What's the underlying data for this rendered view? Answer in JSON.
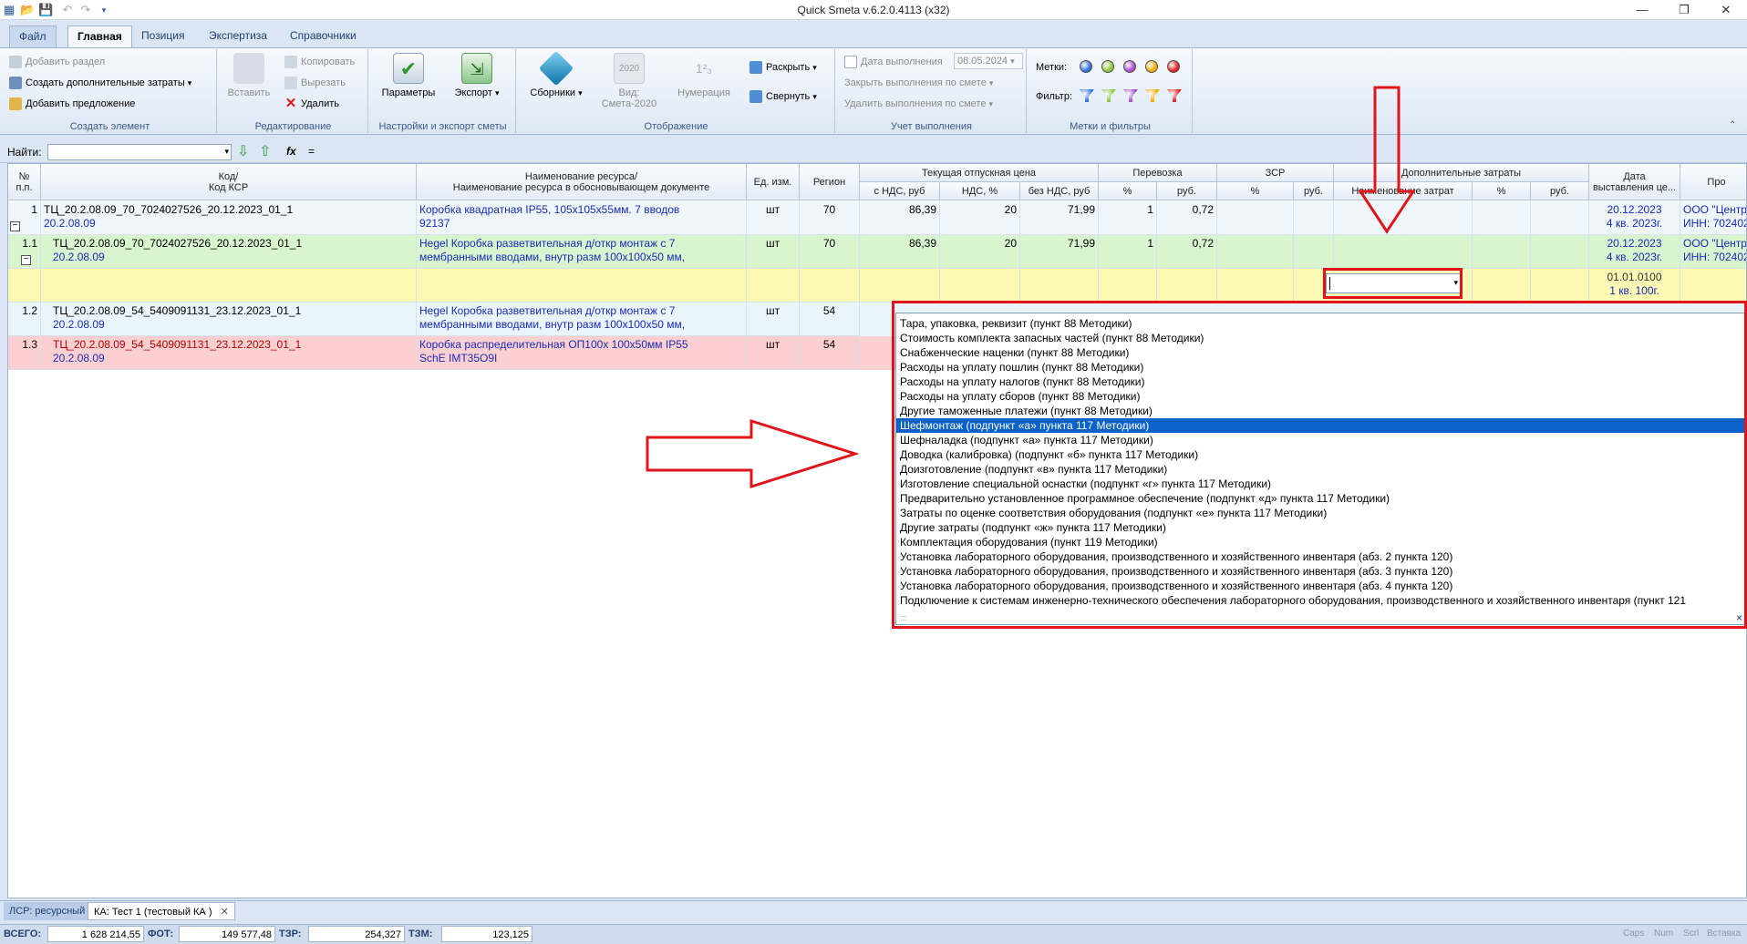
{
  "window": {
    "title": "Quick Smeta v.6.2.0.4113 (x32)",
    "minimize": "—",
    "restore": "❐",
    "close": "✕"
  },
  "ribbon_tabs": [
    "Файл",
    "Главная",
    "Позиция",
    "Экспертиза",
    "Справочники"
  ],
  "ribbon": {
    "create": {
      "add_section": "Добавить раздел",
      "create_extra_costs": "Создать дополнительные затраты",
      "add_offer": "Добавить предложение",
      "title": "Создать элемент"
    },
    "edit": {
      "paste": "Вставить",
      "copy": "Копировать",
      "cut": "Вырезать",
      "delete": "Удалить",
      "title": "Редактирование"
    },
    "settings": {
      "params": "Параметры",
      "export": "Экспорт",
      "title": "Настройки и экспорт сметы"
    },
    "display": {
      "collections": "Сборники",
      "view": "Вид:",
      "view_value": "Смета-2020",
      "numbering": "Нумерация",
      "expand": "Раскрыть",
      "collapse": "Свернуть",
      "title": "Отображение"
    },
    "tracking": {
      "exec_date": "Дата выполнения",
      "exec_date_value": "08.05.2024",
      "close_exec": "Закрыть выполнения по смете",
      "delete_exec": "Удалить выполнения по смете",
      "title": "Учет выполнения"
    },
    "marks": {
      "marks_label": "Метки:",
      "filter_label": "Фильтр:",
      "title": "Метки и фильтры",
      "colors": [
        "#2f6fd6",
        "#8cc63f",
        "#a64ac9",
        "#f2a900",
        "#e02020"
      ]
    }
  },
  "findbar": {
    "label": "Найти:",
    "value": "",
    "fx": "fx",
    "eq": "="
  },
  "headers": {
    "num": "№\nп.п.",
    "code": "Код/\nКод КСР",
    "name": "Наименование ресурса/\nНаименование ресурса в обосновывающем документе",
    "unit": "Ед. изм.",
    "region": "Регион",
    "price_group": "Текущая отпускная цена",
    "price_vat": "с НДС, руб",
    "vat_pct": "НДС, %",
    "price_novat": "без НДС, руб",
    "transport_group": "Перевозка",
    "tr_pct": "%",
    "tr_rub": "руб.",
    "zsr_group": "ЗСР",
    "zsr_pct": "%",
    "zsr_rub": "руб.",
    "extra_group": "Дополнительные затраты",
    "extra_name": "Наименование затрат",
    "extra_pct": "%",
    "extra_rub": "руб.",
    "date": "Дата\nвыставления це...",
    "supplier": "Про"
  },
  "rows": [
    {
      "num": "1",
      "code": "ТЦ_20.2.08.09_70_7024027526_20.12.2023_01_1",
      "ksr": "20.2.08.09",
      "name1": "Коробка квадратная IP55, 105х105х55мм. 7 вводов",
      "name2": "92137",
      "unit": "шт",
      "region": "70",
      "price_vat": "86,39",
      "vat": "20",
      "price_novat": "71,99",
      "tr_pct": "1",
      "tr_rub": "0,72",
      "date1": "20.12.2023",
      "date2": "4 кв. 2023г.",
      "sup1": "ООО \"Центр",
      "sup2": "ИНН: 702402"
    },
    {
      "num": "1.1",
      "code": "ТЦ_20.2.08.09_70_7024027526_20.12.2023_01_1",
      "ksr": "20.2.08.09",
      "name1": "Hegel Коробка разветвительная д/откр монтаж с 7",
      "name2": "мембранными вводами, внутр разм 100х100х50 мм,",
      "unit": "шт",
      "region": "70",
      "price_vat": "86,39",
      "vat": "20",
      "price_novat": "71,99",
      "tr_pct": "1",
      "tr_rub": "0,72",
      "date1": "20.12.2023",
      "date2": "4 кв. 2023г.",
      "sup1": "ООО \"Центр",
      "sup2": "ИНН: 702402"
    },
    {
      "date1": "01.01.0100",
      "date2": "1 кв. 100г."
    },
    {
      "num": "1.2",
      "code": "ТЦ_20.2.08.09_54_5409091131_23.12.2023_01_1",
      "ksr": "20.2.08.09",
      "name1": "Hegel Коробка разветвительная д/откр монтаж с 7",
      "name2": "мембранными вводами, внутр разм 100х100х50 мм,",
      "unit": "шт",
      "region": "54"
    },
    {
      "num": "1.3",
      "code": "ТЦ_20.2.08.09_54_5409091131_23.12.2023_01_1",
      "ksr": "20.2.08.09",
      "name1": "Коробка распределительная ОП100х 100х50мм IP55",
      "name2": "SchE IMT35O9I",
      "unit": "шт",
      "region": "54"
    }
  ],
  "dropdown": {
    "value": "",
    "items": [
      "Тара, упаковка, реквизит (пункт 88 Методики)",
      "Стоимость комплекта запасных частей (пункт 88 Методики)",
      "Снабженческие наценки (пункт 88 Методики)",
      "Расходы на уплату пошлин (пункт 88 Методики)",
      "Расходы на уплату налогов (пункт 88 Методики)",
      "Расходы на уплату сборов (пункт 88 Методики)",
      "Другие таможенные платежи (пункт 88 Методики)",
      "Шефмонтаж (подпункт «а» пункта 117 Методики)",
      "Шефналадка (подпункт «а» пункта 117 Методики)",
      "Доводка (калибровка) (подпункт «б» пункта 117 Методики)",
      "Доизготовление (подпункт «в» пункта 117 Методики)",
      "Изготовление специальной оснастки (подпункт «г» пункта 117 Методики)",
      "Предварительно установленное программное обеспечение (подпункт «д» пункта 117 Методики)",
      "Затраты по оценке соответствия оборудования (подпункт «е» пункта 117 Методики)",
      "Другие затраты (подпункт «ж» пункта 117 Методики)",
      "Комплектация оборудования (пункт 119 Методики)",
      "Установка лабораторного оборудования, производственного и хозяйственного инвентаря (абз. 2 пункта 120)",
      "Установка лабораторного оборудования, производственного и хозяйственного инвентаря (абз. 3 пункта 120)",
      "Установка лабораторного оборудования, производственного и хозяйственного инвентаря (абз. 4 пункта 120)",
      "Подключение к системам инженерно-технического обеспечения лабораторного оборудования, производственного и хозяйственного инвентаря (пункт 121"
    ],
    "selected_index": 7,
    "close": "×"
  },
  "bottom_tabs": [
    "ЛСР: ресурсный",
    "КА: Тест 1 (тестовый КА )"
  ],
  "bottom_tab_close": "✕",
  "status": {
    "total_label": "ВСЕГО:",
    "total_value": "1 628 214,55",
    "fot_label": "ФОТ:",
    "fot_value": "149 577,48",
    "tzr_label": "ТЗР:",
    "tzr_value": "254,327",
    "tzm_label": "ТЗМ:",
    "tzm_value": "123,125",
    "indicators": [
      "Caps",
      "Num",
      "Scrl",
      "Вставка"
    ]
  },
  "accent_colors": {
    "annotation_red": "#e0141b",
    "selection_blue": "#0b63c9",
    "row_green": "#d8f5cf",
    "row_yellow": "#fbf9b3",
    "row_lightblue": "#eaf4fb",
    "row_pink": "#fcd0d0"
  }
}
